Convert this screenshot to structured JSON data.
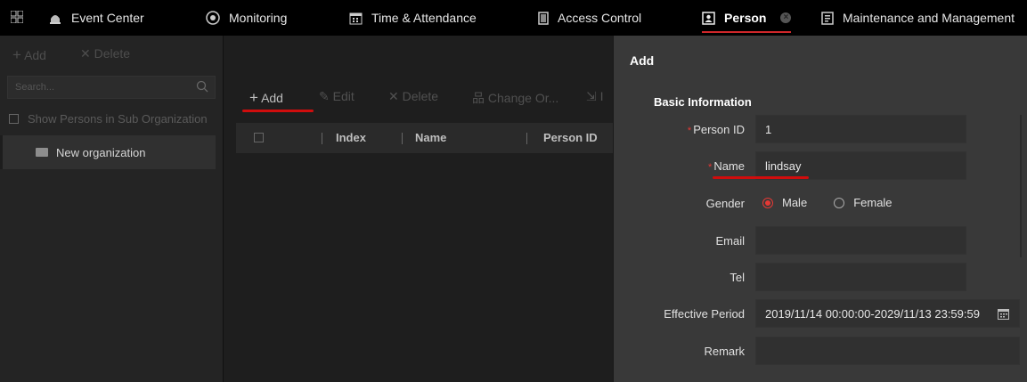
{
  "tabs": [
    {
      "label": "",
      "icon": "app-grid-icon"
    },
    {
      "label": "Event Center",
      "icon": "alarm-icon"
    },
    {
      "label": "Monitoring",
      "icon": "monitoring-icon"
    },
    {
      "label": "Time & Attendance",
      "icon": "calendar-icon"
    },
    {
      "label": "Access Control",
      "icon": "door-icon"
    },
    {
      "label": "Person",
      "icon": "person-card-icon"
    },
    {
      "label": "Maintenance and Management",
      "icon": "maintenance-icon"
    }
  ],
  "org_panel": {
    "add_label": "Add",
    "delete_label": "Delete",
    "search_placeholder": "Search...",
    "sub_org_label": "Show Persons in Sub Organization",
    "org_item": "New organization"
  },
  "toolbar": {
    "add": "Add",
    "edit": "Edit",
    "delete": "Delete",
    "change_org": "Change Or...",
    "import": "I"
  },
  "table": {
    "columns": [
      "Index",
      "Name",
      "Person ID"
    ]
  },
  "dialog": {
    "title": "Add",
    "section": "Basic Information",
    "person_id_label": "Person ID",
    "person_id_value": "1",
    "name_label": "Name",
    "name_value": "lindsay",
    "gender_label": "Gender",
    "gender_options": [
      "Male",
      "Female"
    ],
    "gender_selected": "Male",
    "email_label": "Email",
    "tel_label": "Tel",
    "effective_period_label": "Effective Period",
    "effective_period_value": "2019/11/14 00:00:00-2029/11/13 23:59:59",
    "remark_label": "Remark"
  },
  "colors": {
    "accent": "#d0272a",
    "annotation": "#d00d0d"
  }
}
